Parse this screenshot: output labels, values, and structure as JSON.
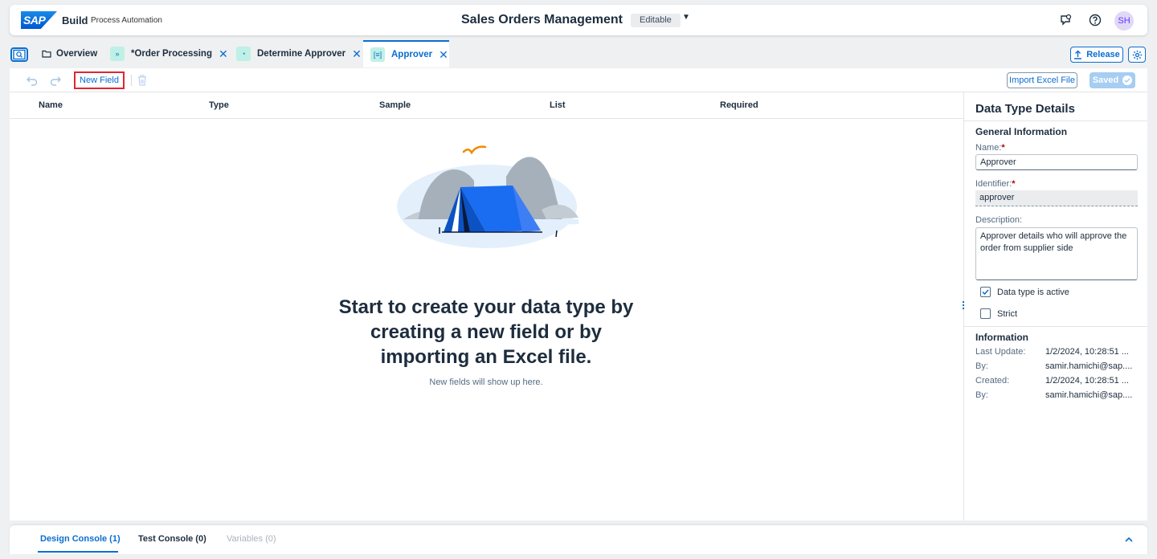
{
  "shell": {
    "logo_text": "SAP",
    "product": "Build",
    "subtitle": "Process Automation",
    "title": "Sales Orders Management",
    "status": "Editable",
    "avatar_initials": "SH"
  },
  "tabs": [
    {
      "label": "Overview",
      "icon": "folder-icon"
    },
    {
      "label": "*Order Processing",
      "icon": "process-icon"
    },
    {
      "label": "Determine Approver",
      "icon": "decision-icon"
    },
    {
      "label": "Approver",
      "icon": "data-type-icon"
    }
  ],
  "actions": {
    "release": "Release"
  },
  "toolbar": {
    "new_field": "New Field",
    "import_excel": "Import Excel File",
    "saved": "Saved"
  },
  "table": {
    "columns": [
      "Name",
      "Type",
      "Sample",
      "List",
      "Required"
    ]
  },
  "empty_state": {
    "title": "Start to create your data type by creating a new field or by importing an Excel file.",
    "subtitle": "New fields will show up here."
  },
  "details": {
    "title": "Data Type Details",
    "general_section": "General Information",
    "name_label": "Name:",
    "name_value": "Approver",
    "identifier_label": "Identifier:",
    "identifier_value": "approver",
    "description_label": "Description:",
    "description_value": "Approver details who will approve the order from supplier side",
    "active_label": "Data type is active",
    "active_checked": true,
    "strict_label": "Strict",
    "strict_checked": false,
    "info_section": "Information",
    "info": [
      {
        "label": "Last Update:",
        "value": "1/2/2024, 10:28:51 ..."
      },
      {
        "label": "By:",
        "value": "samir.hamichi@sap...."
      },
      {
        "label": "Created:",
        "value": "1/2/2024, 10:28:51 ..."
      },
      {
        "label": "By:",
        "value": "samir.hamichi@sap...."
      }
    ]
  },
  "console": {
    "tabs": [
      "Design Console (1)",
      "Test Console (0)",
      "Variables (0)"
    ]
  },
  "colors": {
    "accent": "#0a6ed1",
    "highlight_border": "#e0262d",
    "tent": "#1a6cf0",
    "mountain": "#a6b0bb"
  }
}
